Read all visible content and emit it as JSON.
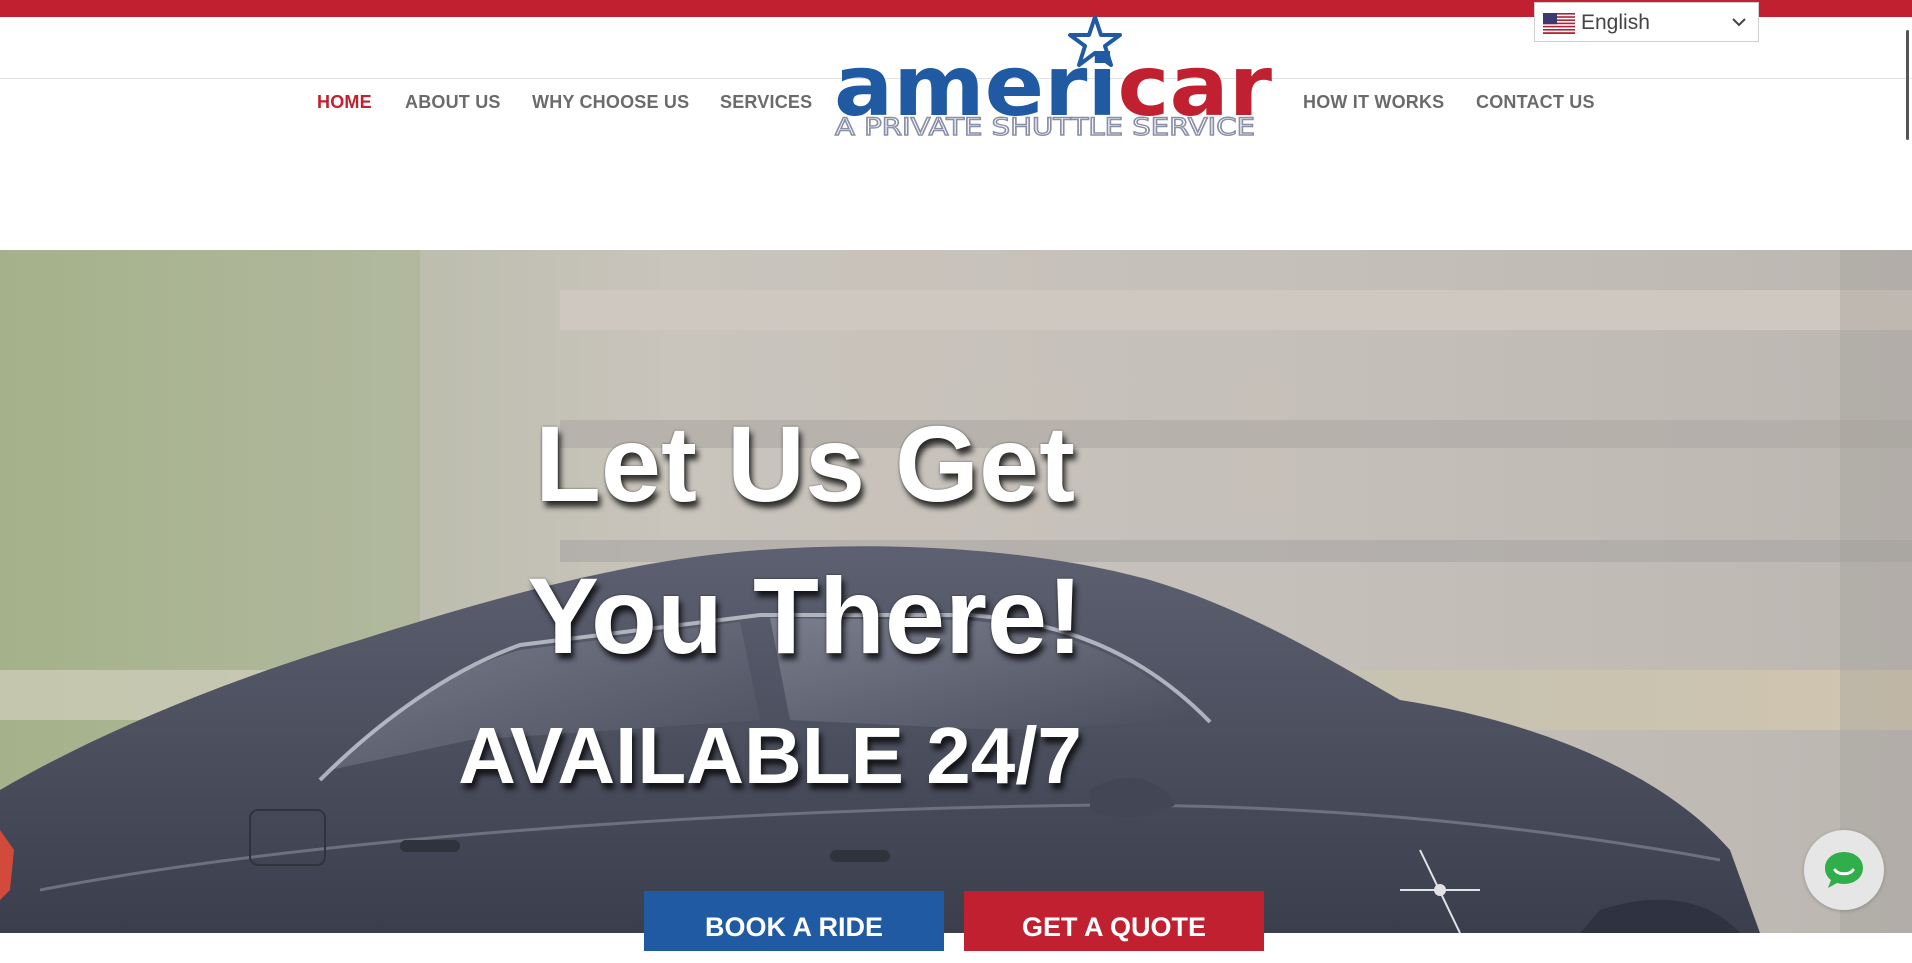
{
  "language": {
    "selected": "English"
  },
  "nav": {
    "left": [
      "HOME",
      "ABOUT US",
      "WHY CHOOSE US",
      "SERVICES"
    ],
    "right": [
      "HOW IT WORKS",
      "CONTACT US"
    ],
    "active": "HOME"
  },
  "logo": {
    "name": "americar",
    "name_blue": "ameri",
    "name_red": "car",
    "tagline": "A PRIVATE SHUTTLE SERVICE"
  },
  "hero": {
    "title_line1": "Let Us Get",
    "title_line2": "You There!",
    "subtitle": "AVAILABLE 24/7",
    "book_button": "BOOK A RIDE",
    "quote_button": "GET A QUOTE"
  },
  "colors": {
    "brand_red": "#c0202f",
    "brand_blue": "#1f5aa3",
    "nav_text": "#6b6b6b"
  },
  "icons": {
    "language_flag": "us-flag-icon",
    "dropdown": "chevron-down-icon",
    "chat": "chat-bubble-icon"
  }
}
